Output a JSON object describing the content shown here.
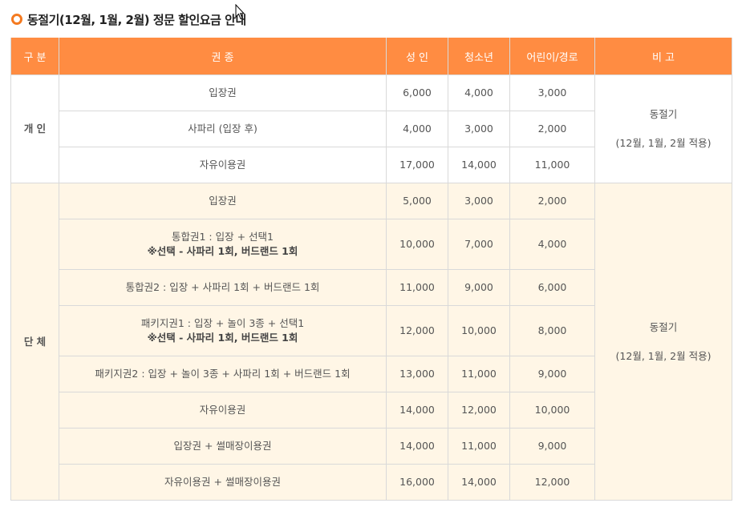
{
  "page": {
    "title": "동절기(12월, 1월, 2월) 정문 할인요금 안내"
  },
  "table": {
    "headers": [
      "구 분",
      "권 종",
      "성 인",
      "청소년",
      "어린이/경로",
      "비 고"
    ],
    "individual": {
      "category": "개 인",
      "remark_line1": "동절기",
      "remark_line2": "(12월, 1월, 2월 적용)",
      "rows": [
        {
          "ticket": "입장권",
          "note": "",
          "adult": "6,000",
          "youth": "4,000",
          "child": "3,000"
        },
        {
          "ticket": "사파리 (입장 후)",
          "note": "",
          "adult": "4,000",
          "youth": "3,000",
          "child": "2,000"
        },
        {
          "ticket": "자유이용권",
          "note": "",
          "adult": "17,000",
          "youth": "14,000",
          "child": "11,000"
        }
      ]
    },
    "group": {
      "category": "단 체",
      "remark_line1": "동절기",
      "remark_line2": "(12월, 1월, 2월 적용)",
      "rows": [
        {
          "ticket": "입장권",
          "note": "",
          "adult": "5,000",
          "youth": "3,000",
          "child": "2,000"
        },
        {
          "ticket": "통합권1 : 입장 + 선택1",
          "note": "※선택 - 사파리 1회, 버드랜드 1회",
          "adult": "10,000",
          "youth": "7,000",
          "child": "4,000"
        },
        {
          "ticket": "통합권2 : 입장 + 사파리 1회 + 버드랜드 1회",
          "note": "",
          "adult": "11,000",
          "youth": "9,000",
          "child": "6,000"
        },
        {
          "ticket": "패키지권1 : 입장 + 놀이 3종 + 선택1",
          "note": "※선택 - 사파리 1회, 버드랜드 1회",
          "adult": "12,000",
          "youth": "10,000",
          "child": "8,000"
        },
        {
          "ticket": "패키지권2 : 입장 + 놀이 3종 + 사파리 1회 + 버드랜드 1회",
          "note": "",
          "adult": "13,000",
          "youth": "11,000",
          "child": "9,000"
        },
        {
          "ticket": "자유이용권",
          "note": "",
          "adult": "14,000",
          "youth": "12,000",
          "child": "10,000"
        },
        {
          "ticket": "입장권 + 썰매장이용권",
          "note": "",
          "adult": "14,000",
          "youth": "11,000",
          "child": "9,000"
        },
        {
          "ticket": "자유이용권 + 썰매장이용권",
          "note": "",
          "adult": "16,000",
          "youth": "14,000",
          "child": "12,000"
        }
      ]
    }
  },
  "colors": {
    "header_bg": "#ff8c42",
    "group_bg": "#fff6e6",
    "bullet": "#f47a20"
  }
}
